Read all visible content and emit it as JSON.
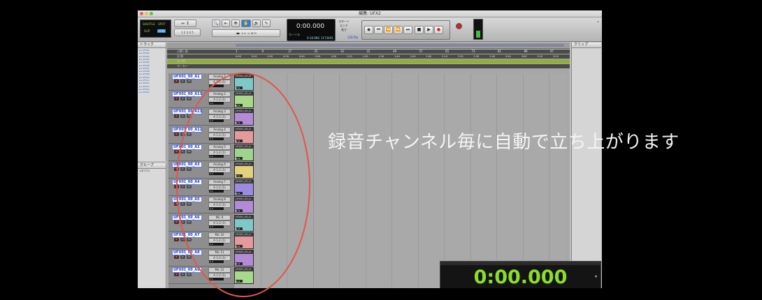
{
  "window": {
    "title": "編集: UFX2"
  },
  "toolbar": {
    "modes": [
      "SHUFFLE",
      "SPOT",
      "SLIP",
      "GRID"
    ],
    "counter_main": "0:00.000",
    "counter_label": "カーソル",
    "counter_sub1": "0:10.966",
    "counter_sub2": "1173401",
    "counter_sub3": "128 Dly",
    "start_labels": [
      "スタート",
      "エンド",
      "長さ"
    ]
  },
  "left_panels": {
    "tracks_title": "トラック",
    "groups_title": "グループ",
    "groups_item": "<すべて>",
    "track_list": [
      "UFX01",
      "UFX02",
      "UFX03",
      "UFX04",
      "UFX05",
      "UFX06",
      "UFX07",
      "UFX08",
      "UFX09",
      "UFX10",
      "UFX11",
      "UFX12",
      "UFX13",
      "UFX14",
      "UFX15"
    ]
  },
  "ruler": {
    "rows": [
      "小節 | 拍",
      "分:秒",
      "テンポ",
      "マーカー"
    ],
    "bars": [
      "1",
      "9",
      "17",
      "25",
      "33",
      "41",
      "49",
      "57",
      "65",
      "73",
      "81",
      "89",
      "97"
    ],
    "times": [
      "0:00",
      "0:10",
      "0:20",
      "0:30",
      "0:40",
      "0:50",
      "1:00",
      "1:10",
      "1:20",
      "1:30",
      "1:40",
      "1:50",
      "2:00",
      "2:10",
      "2:20",
      "2:30",
      "2:40",
      "2:50",
      "3:00",
      "3:10",
      "3:20"
    ]
  },
  "tracks": [
    {
      "name": "UFX01_00_A1",
      "io": "Analog 1",
      "out": "A 1-2 (1)",
      "clip": "UFX01_00_A",
      "color": "#7ec8c8"
    },
    {
      "name": "UFX01_00_A11",
      "io": "Analog 2",
      "out": "A 1-2 (1)",
      "clip": "UFX01_00_A",
      "color": "#a7d98a"
    },
    {
      "name": "UFX01_00_A11",
      "io": "Analog 3",
      "out": "A 1-2 (1)",
      "clip": "UFX01_00_A",
      "color": "#b38ad6"
    },
    {
      "name": "UFX01_00_A12",
      "io": "Analog 4",
      "out": "A 1-2 (1)",
      "clip": "UFX01_00_A",
      "color": "#e49a9a"
    },
    {
      "name": "UFX01_00_A2",
      "io": "Analog 5",
      "out": "A 1-2 (1)",
      "clip": "UFX01_00_A",
      "color": "#9fd48e"
    },
    {
      "name": "UFX01_00_A3",
      "io": "Analog 6",
      "out": "A 1-2 (1)",
      "clip": "UFX01_00_A",
      "color": "#e2d27c"
    },
    {
      "name": "UFX01_00_A4",
      "io": "Analog 7",
      "out": "A 1-2 (1)",
      "clip": "UFX01_00_A",
      "color": "#9a8be0"
    },
    {
      "name": "UFX01_00_A5",
      "io": "Analog 8",
      "out": "A 1-2 (1)",
      "clip": "UFX01_00_A",
      "color": "#b38ad6"
    },
    {
      "name": "UFX01_00_A6",
      "io": "Mic 9",
      "out": "A 1-2 (1)",
      "clip": "UFX01_00_A",
      "color": "#7ec8c8"
    },
    {
      "name": "UFX01_00_A7",
      "io": "Mic 10",
      "out": "A 1-2 (1)",
      "clip": "UFX01_00_A",
      "color": "#e49a9a"
    },
    {
      "name": "UFX01_00_A8",
      "io": "Mic 11",
      "out": "A 1-2 (1)",
      "clip": "UFX01_00_A",
      "color": "#b38ad6"
    },
    {
      "name": "UFX01_00_A9",
      "io": "Mic 12",
      "out": "A 1-2 (1)",
      "clip": "UFX01_00_A",
      "color": "#a7d98a"
    }
  ],
  "right_panel": {
    "title": "クリップ"
  },
  "big_counter": {
    "time": "0:00.000"
  },
  "annotation": {
    "text": "録音チャンネル毎に自動で立ち上がります",
    "ellipse_color": "#e0574a"
  }
}
